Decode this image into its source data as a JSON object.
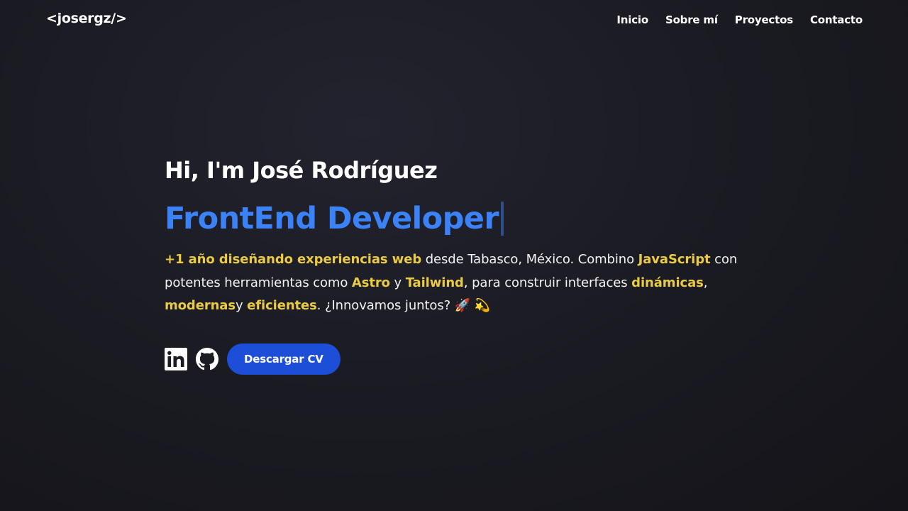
{
  "header": {
    "logo": "<josergz/>",
    "nav": [
      {
        "label": "Inicio"
      },
      {
        "label": "Sobre mí"
      },
      {
        "label": "Proyectos"
      },
      {
        "label": "Contacto"
      }
    ]
  },
  "hero": {
    "greeting": "Hi, I'm José Rodríguez",
    "role": "FrontEnd Developer",
    "bio": {
      "p1_hl": "+1 año diseñando experiencias web",
      "p2": " desde Tabasco, México. Combino ",
      "p3_hl": "JavaScript",
      "p4": " con potentes herramientas como ",
      "p5_hl": "Astro",
      "p6": " y ",
      "p7_hl": "Tailwind",
      "p8": ", para construir interfaces ",
      "p9_hl": "dinámicas",
      "p10": ", ",
      "p11_hl": "modernas",
      "p12": "y ",
      "p13_hl": "eficientes",
      "p14": ". ¿Innovamos juntos? 🚀 💫"
    },
    "social": [
      {
        "icon": "linkedin-icon"
      },
      {
        "icon": "github-icon"
      }
    ],
    "cv_button": "Descargar CV"
  },
  "colors": {
    "accent_blue": "#3b82f6",
    "button_blue": "#1d4ed8",
    "highlight_yellow": "#ebcb43",
    "background": "#1b1b23"
  }
}
